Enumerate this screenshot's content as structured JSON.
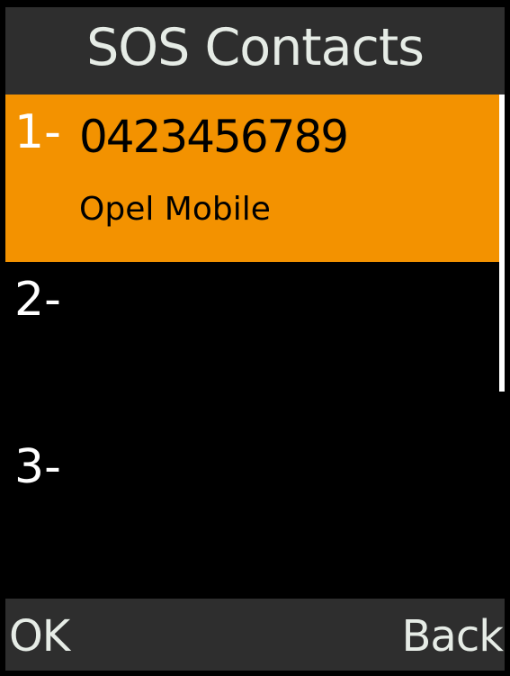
{
  "header": {
    "title": "SOS Contacts"
  },
  "contacts": [
    {
      "index": "1-",
      "number": "0423456789",
      "name": "Opel Mobile",
      "selected": true
    },
    {
      "index": "2-",
      "number": "",
      "name": "",
      "selected": false
    },
    {
      "index": "3-",
      "number": "",
      "name": "",
      "selected": false
    }
  ],
  "softkeys": {
    "left": "OK",
    "right": "Back"
  },
  "colors": {
    "highlight": "#f39200",
    "bar": "#2e2e2e",
    "background": "#000000"
  }
}
